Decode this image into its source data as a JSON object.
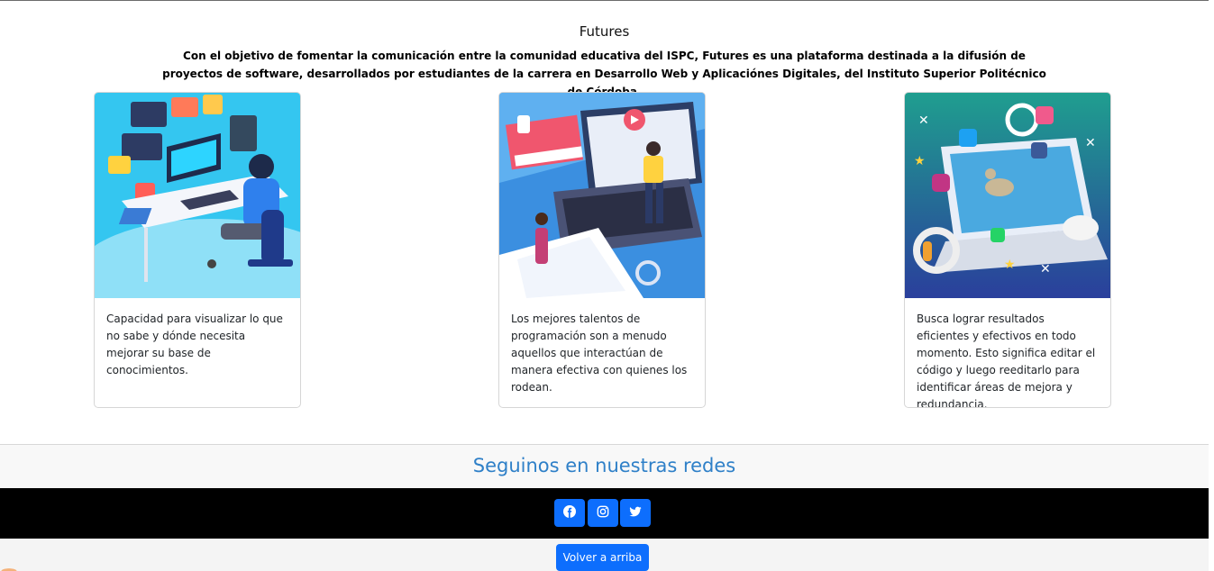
{
  "intro": {
    "title": "Futures",
    "description": "Con el objetivo de fomentar la comunicación entre la comunidad educativa del ISPC, Futures es una plataforma destinada a la difusión de proyectos de software, desarrollados por estudiantes de la carrera en Desarrollo Web y Aplicaciónes Digitales, del Instituto Superior Politécnico de Córdoba."
  },
  "cards": [
    {
      "text": "Capacidad para visualizar lo que no sabe y dónde necesita mejorar su base de conocimientos.",
      "image_icon": "developer-illustration"
    },
    {
      "text": "Los mejores talentos de programación son a menudo aquellos que interactúan de manera efectiva con quienes los rodean.",
      "image_icon": "education-illustration"
    },
    {
      "text": "Busca lograr resultados eficientes y efectivos en todo momento. Esto significa editar el código y luego reeditarlo para identificar áreas de mejora y redundancia.",
      "image_icon": "social-media-illustration"
    }
  ],
  "social": {
    "heading": "Seguinos en nuestras redes",
    "buttons": [
      {
        "icon": "facebook-icon"
      },
      {
        "icon": "instagram-icon"
      },
      {
        "icon": "twitter-icon"
      }
    ]
  },
  "footer": {
    "back_to_top_label": "Volver a arriba"
  },
  "colors": {
    "accent": "#0d6efd",
    "heading": "#2f80c8",
    "social_bar": "#000000"
  }
}
